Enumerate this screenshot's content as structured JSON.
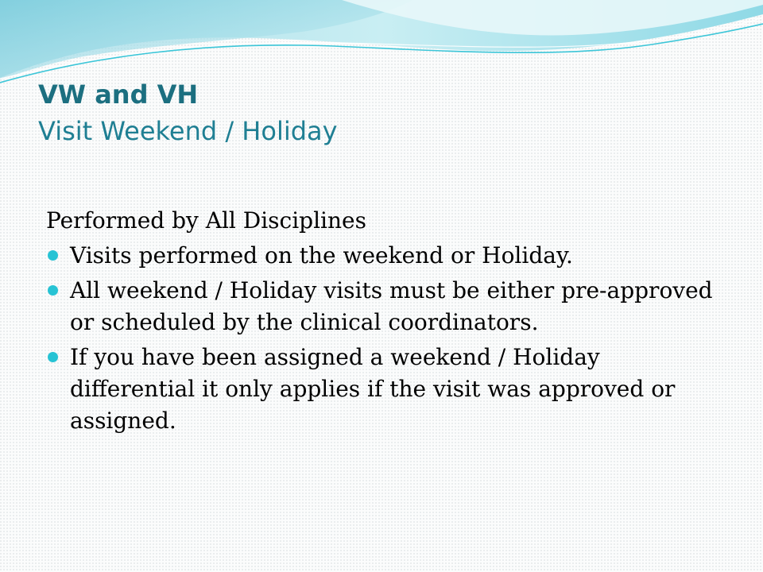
{
  "slide": {
    "title": "VW and VH",
    "subtitle": "Visit Weekend / Holiday",
    "lead": "Performed by  All Disciplines",
    "bullets": [
      "Visits performed on the weekend or Holiday.",
      "All weekend / Holiday visits must be either pre-approved or scheduled by the clinical coordinators.",
      "If you have been assigned a weekend / Holiday differential it only applies if the visit was approved or assigned."
    ],
    "colors": {
      "title": "#1c6f80",
      "bullet": "#27c3d4",
      "wave_light": "#bfe9ef",
      "wave_accent": "#3cc6d8"
    },
    "icons": {
      "bullet": "bullet-dot-icon",
      "decoration": "wave-decoration"
    }
  }
}
